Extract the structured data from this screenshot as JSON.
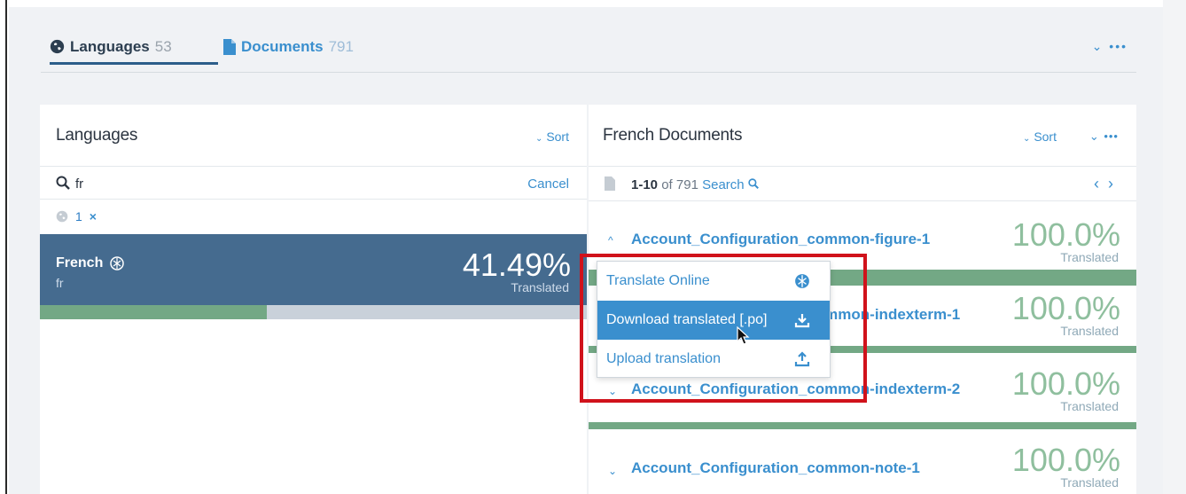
{
  "tabs": {
    "languages": {
      "label": "Languages",
      "count": "53"
    },
    "documents": {
      "label": "Documents",
      "count": "791"
    },
    "more": "⌄ •••"
  },
  "languages_panel": {
    "title": "Languages",
    "sort_label": "Sort",
    "search": {
      "value": "fr",
      "cancel_label": "Cancel"
    },
    "filter": {
      "count": "1",
      "clear": "×"
    },
    "selected_language": {
      "name": "French",
      "code": "fr",
      "percent": "41.49%",
      "status": "Translated",
      "progress_fraction": 0.415
    }
  },
  "documents_panel": {
    "title": "French Documents",
    "sort_label": "Sort",
    "more": "⌄ •••",
    "range": {
      "shown": "1-10",
      "of_label": "of 791",
      "search_label": "Search"
    },
    "nav": {
      "prev": "‹",
      "next": "›"
    },
    "items": [
      {
        "name": "Account_Configuration_common-figure-1",
        "percent": "100.0%",
        "status": "Translated",
        "chevron": "^"
      },
      {
        "name": "Account_Configuration_common-indexterm-1",
        "percent": "100.0%",
        "status": "Translated",
        "chevron": "⌄"
      },
      {
        "name": "Account_Configuration_common-indexterm-2",
        "percent": "100.0%",
        "status": "Translated",
        "chevron": "⌄"
      },
      {
        "name": "Account_Configuration_common-note-1",
        "percent": "100.0%",
        "status": "Translated",
        "chevron": "⌄"
      }
    ]
  },
  "doc_menu": {
    "items": [
      {
        "label": "Translate Online",
        "icon": "zanata-translate-icon"
      },
      {
        "label": "Download translated [.po]",
        "icon": "download-icon"
      },
      {
        "label": "Upload translation",
        "icon": "upload-icon"
      }
    ]
  },
  "colors": {
    "accent": "#3a8fce",
    "selected_row": "#456b8f",
    "progress_green": "#73a885",
    "highlight_red": "#d0121b"
  }
}
